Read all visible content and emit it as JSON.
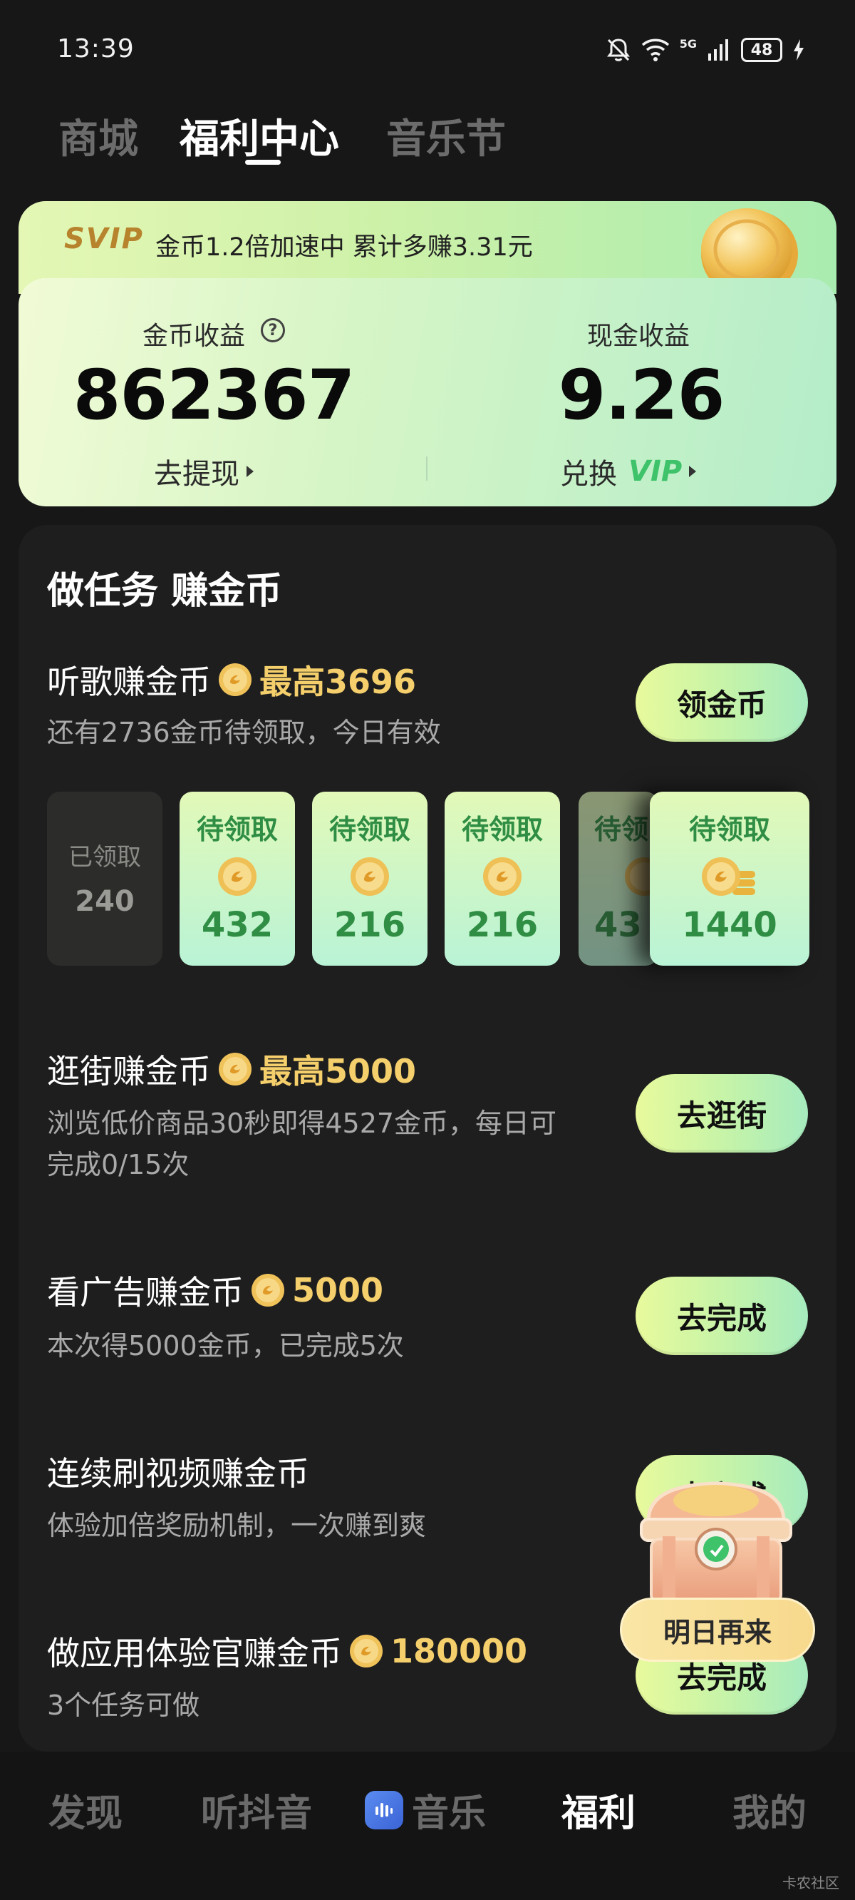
{
  "status_bar": {
    "time": "13:39",
    "network": "5G",
    "battery": "48"
  },
  "top_tabs": [
    {
      "label": "商城",
      "active": false
    },
    {
      "label": "福利中心",
      "active": true
    },
    {
      "label": "音乐节",
      "active": false
    }
  ],
  "svip_banner": {
    "tag": "SVIP",
    "text": "金币1.2倍加速中 累计多赚3.31元"
  },
  "earnings": {
    "coin_label": "金币收益",
    "coin_value": "862367",
    "coin_link": "去提现",
    "cash_label": "现金收益",
    "cash_value": "9.26",
    "cash_link": "兑换",
    "cash_link_vip": "VIP"
  },
  "tasks": {
    "section_title": "做任务 赚金币",
    "listen": {
      "title": "听歌赚金币",
      "reward": "最高3696",
      "desc": "还有2736金币待领取，今日有效",
      "button": "领金币",
      "tiles": [
        {
          "label": "已领取",
          "value": "240",
          "state": "claimed"
        },
        {
          "label": "待领取",
          "value": "432",
          "state": "pending"
        },
        {
          "label": "待领取",
          "value": "216",
          "state": "pending"
        },
        {
          "label": "待领取",
          "value": "216",
          "state": "pending"
        },
        {
          "label": "待领",
          "value": "43",
          "state": "pending"
        },
        {
          "label": "待领取",
          "value": "1440",
          "state": "pending"
        }
      ]
    },
    "shop": {
      "title": "逛街赚金币",
      "reward": "最高5000",
      "desc_line1": "浏览低价商品30秒即得4527金币，每日可",
      "desc_line2": "完成0/15次",
      "button": "去逛街"
    },
    "ad": {
      "title": "看广告赚金币",
      "reward": "5000",
      "desc": "本次得5000金币，已完成5次",
      "button": "去完成"
    },
    "video": {
      "title": "连续刷视频赚金币",
      "desc": "体验加倍奖励机制，一次赚到爽",
      "button": "去完成"
    },
    "app": {
      "title": "做应用体验官赚金币",
      "reward": "180000",
      "desc": "3个任务可做",
      "button": "去完成"
    }
  },
  "chest": {
    "label": "明日再来"
  },
  "bottom_nav": [
    {
      "label": "发现",
      "active": false
    },
    {
      "label": "听抖音",
      "active": false
    },
    {
      "label": "音乐",
      "active": false
    },
    {
      "label": "福利",
      "active": true
    },
    {
      "label": "我的",
      "active": false
    }
  ],
  "watermark": "卡农社区",
  "colors": {
    "accent_green": "#2f8e44",
    "reward_gold": "#f5cf6b",
    "background": "#171717"
  }
}
